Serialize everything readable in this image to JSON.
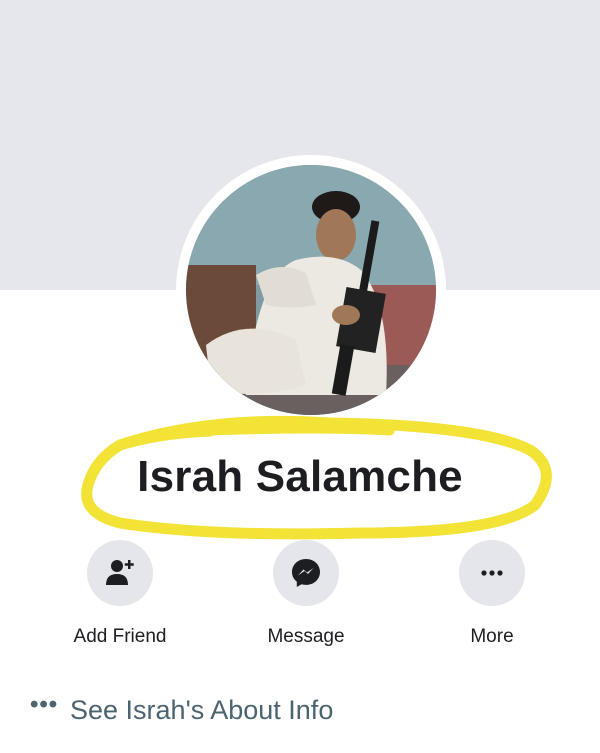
{
  "profile": {
    "name": "Israh Salamche",
    "photo_icon": "profile-photo"
  },
  "actions": [
    {
      "label": "Add Friend",
      "icon": "add-friend-icon"
    },
    {
      "label": "Message",
      "icon": "messenger-icon"
    },
    {
      "label": "More",
      "icon": "more-icon"
    }
  ],
  "about": {
    "dots": "•••",
    "label": "See Israh's About Info",
    "icon": "more-dots-icon"
  },
  "colors": {
    "cover": "#e6e7ec",
    "highlight": "#f2e336",
    "action_bg": "#e4e6eb",
    "about_text": "#4b6470"
  }
}
